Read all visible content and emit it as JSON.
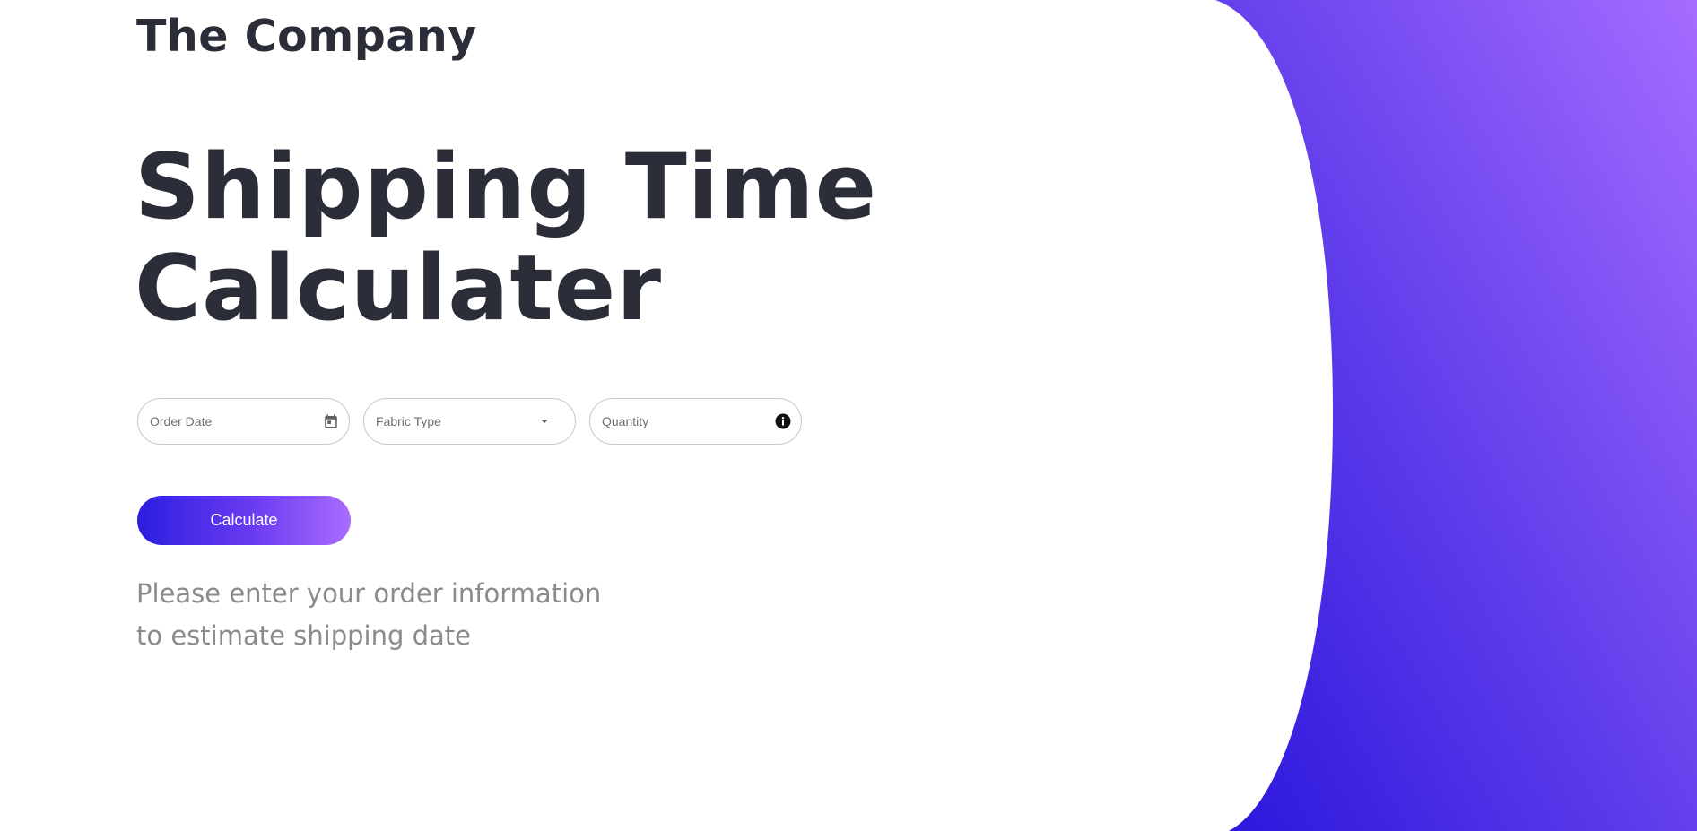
{
  "brand": {
    "name": "The Company"
  },
  "hero": {
    "title_line1": "Shipping Time",
    "title_line2": "Calculater"
  },
  "form": {
    "order_date": {
      "placeholder": "Order Date",
      "icon": "calendar-icon"
    },
    "fabric_type": {
      "placeholder": "Fabric Type",
      "icon": "dropdown-arrow-icon"
    },
    "quantity": {
      "placeholder": "Quantity",
      "icon": "info-icon"
    },
    "calculate_label": "Calculate"
  },
  "message": {
    "line1": "Please enter your order information",
    "line2": "to estimate shipping date"
  },
  "colors": {
    "text_dark": "#2b2d38",
    "text_muted": "#8a8a8f",
    "gradient_start": "#2b1ee0",
    "gradient_end": "#a96cff"
  }
}
